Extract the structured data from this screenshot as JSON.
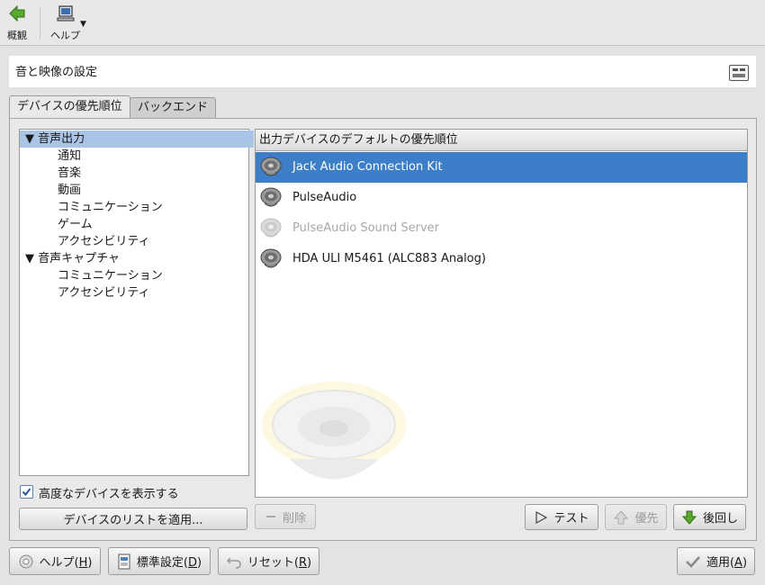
{
  "toolbar": {
    "back_label": "概観",
    "help_label": "ヘルプ"
  },
  "header": {
    "title": "音と映像の設定"
  },
  "tabs": [
    {
      "label": "デバイスの優先順位",
      "active": true
    },
    {
      "label": "バックエンド",
      "active": false
    }
  ],
  "tree": {
    "items": [
      {
        "label": "▼ 音声出力",
        "level": 0,
        "selected": true
      },
      {
        "label": "通知",
        "level": 1
      },
      {
        "label": "音楽",
        "level": 1
      },
      {
        "label": "動画",
        "level": 1
      },
      {
        "label": "コミュニケーション",
        "level": 1
      },
      {
        "label": "ゲーム",
        "level": 1
      },
      {
        "label": "アクセシビリティ",
        "level": 1
      },
      {
        "label": "▼ 音声キャプチャ",
        "level": 0
      },
      {
        "label": "コミュニケーション",
        "level": 1
      },
      {
        "label": "アクセシビリティ",
        "level": 1
      }
    ]
  },
  "devices": {
    "header": "出力デバイスのデフォルトの優先順位",
    "items": [
      {
        "label": "Jack Audio Connection Kit",
        "selected": true
      },
      {
        "label": "PulseAudio"
      },
      {
        "label": "PulseAudio Sound Server",
        "disabled": true
      },
      {
        "label": "HDA ULI M5461 (ALC883 Analog)"
      }
    ]
  },
  "advanced_checkbox": {
    "label": "高度なデバイスを表示する",
    "checked": true
  },
  "buttons": {
    "apply_list": "デバイスのリストを適用...",
    "remove": "削除",
    "test": "テスト",
    "prefer": "優先",
    "defer": "後回し"
  },
  "footer": {
    "help_text": "ヘルプ(",
    "help_key": "H",
    "defaults_text": "標準設定(",
    "defaults_key": "D",
    "reset_text": "リセット(",
    "reset_key": "R",
    "apply_text": "適用(",
    "apply_key": "A",
    "close_paren": ")"
  },
  "colors": {
    "selection": "#3c7fc8",
    "tree_selection": "#aac4e6",
    "back_arrow": "#4a9a2a"
  }
}
